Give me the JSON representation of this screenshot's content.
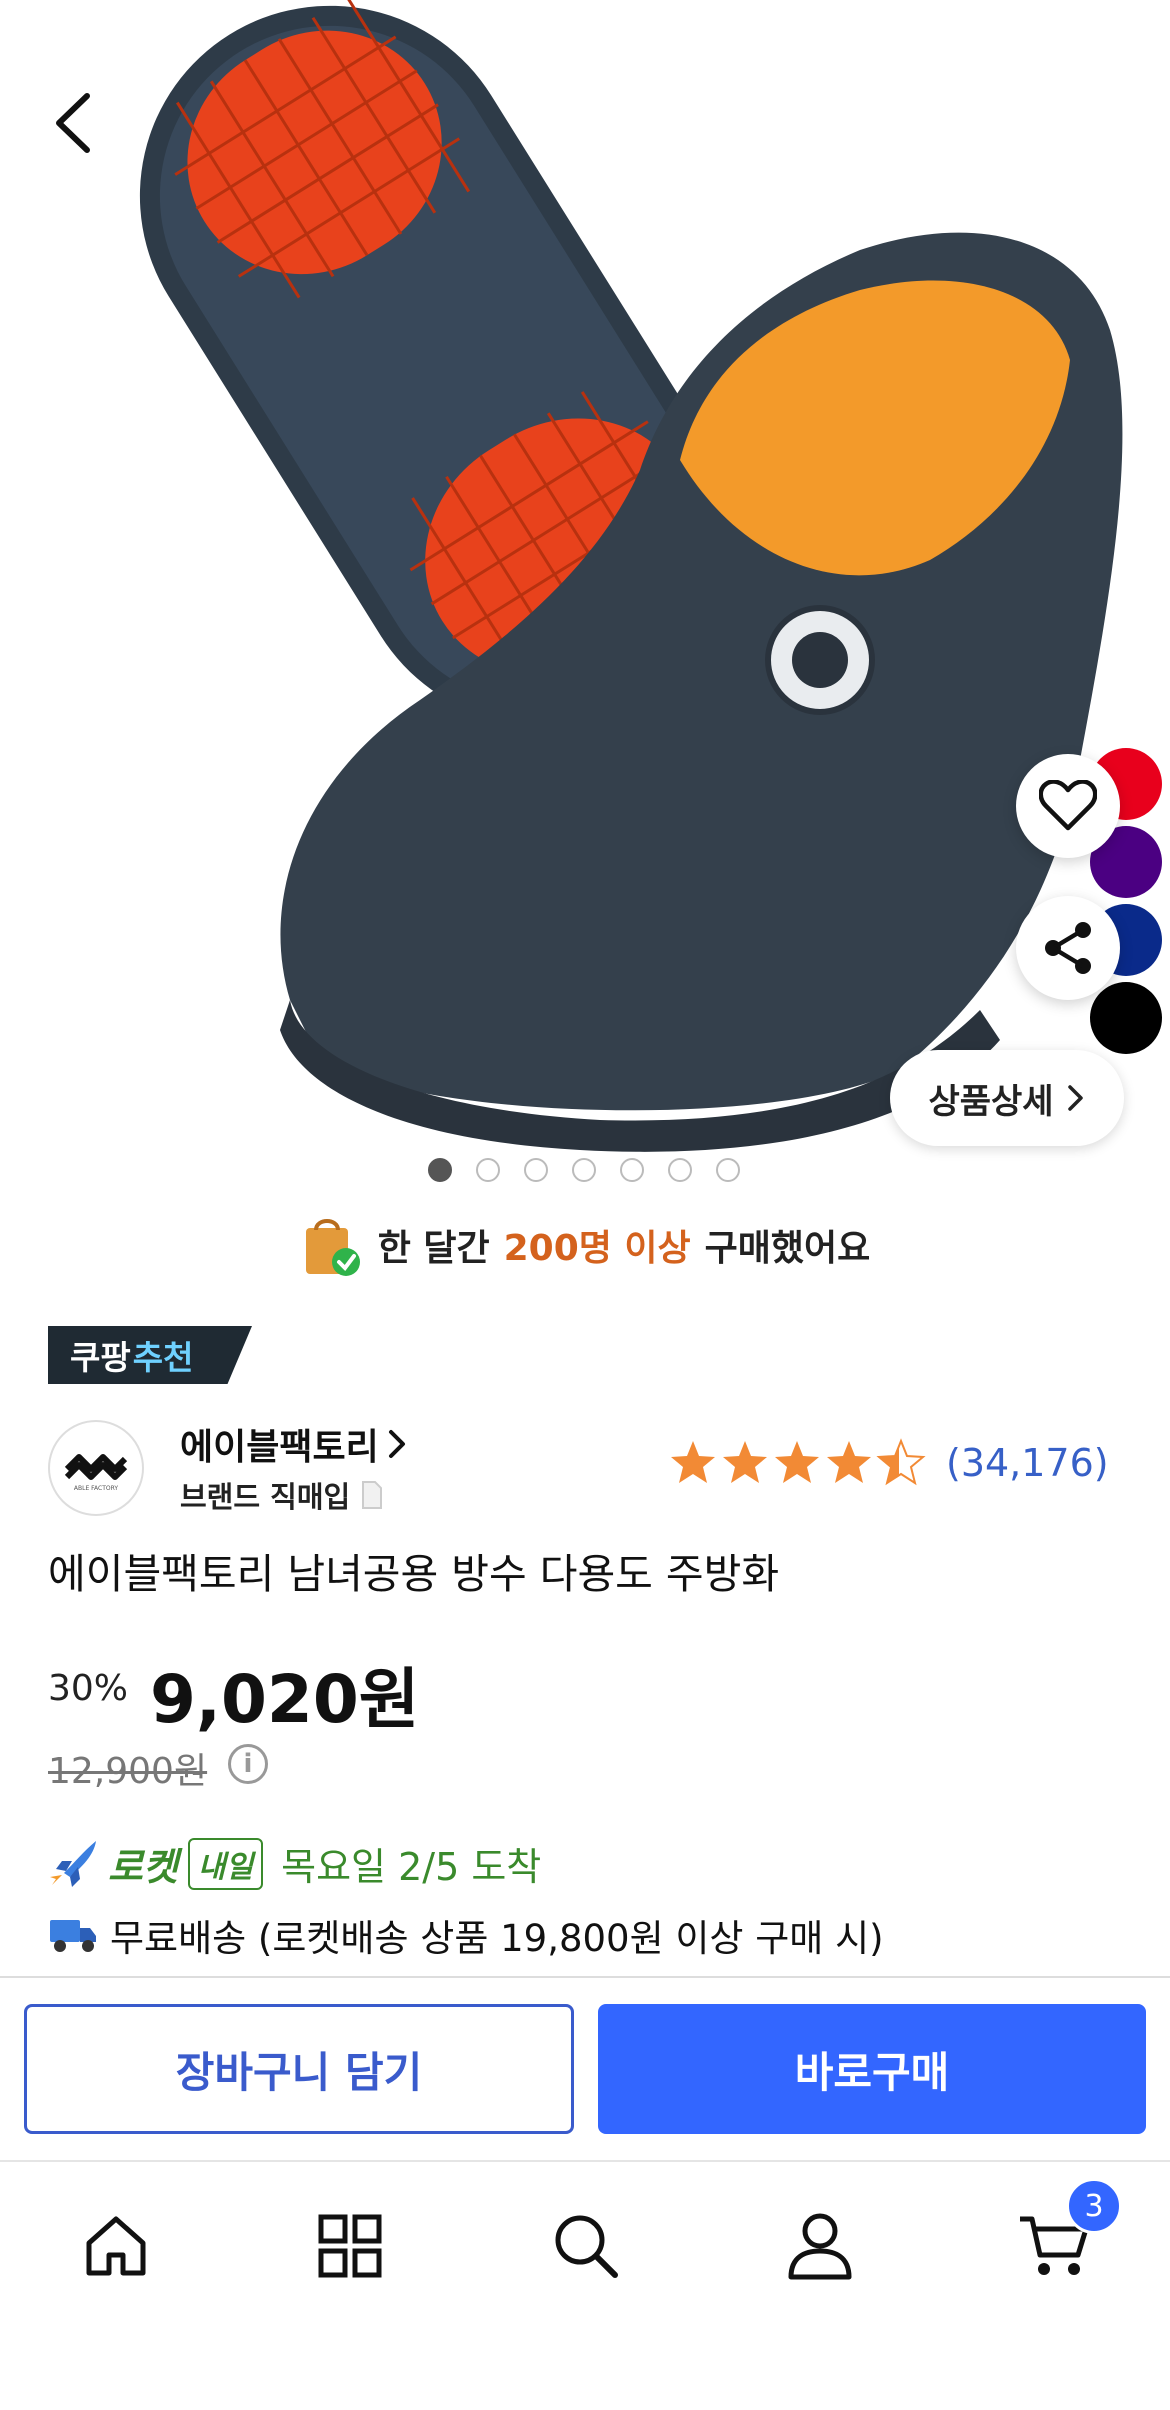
{
  "product_gallery": {
    "active_index": 0,
    "dot_count": 7,
    "color_swatches": [
      "#e8001c",
      "#4b0082",
      "#0a2a8a",
      "#000000"
    ],
    "detail_button_label": "상품상세"
  },
  "social_proof": {
    "prefix": "한 달간",
    "highlight": "200명 이상",
    "suffix": "구매했어요"
  },
  "badge": {
    "part1": "쿠팡",
    "part2": "추천"
  },
  "brand": {
    "name": "에이블팩토리",
    "sub": "브랜드 직매입",
    "logo_caption": "ABLE FACTORY"
  },
  "rating": {
    "stars": 4.5,
    "count": "(34,176)"
  },
  "product_title": "에이블팩토리 남녀공용 방수 다용도 주방화",
  "price": {
    "discount": "30%",
    "sale": "9,020원",
    "original": "12,900원",
    "info_glyph": "i"
  },
  "delivery": {
    "rocket_label": "로켓",
    "tomorrow_label": "내일",
    "arrival": "목요일 2/5 도착",
    "shipping": "무료배송 (로켓배송 상품 19,800원 이상 구매 시)"
  },
  "actions": {
    "cart": "장바구니 담기",
    "buy": "바로구매"
  },
  "bottom_nav": {
    "items": [
      "home-icon",
      "category-icon",
      "search-icon",
      "account-icon",
      "cart-icon"
    ],
    "cart_count": "3"
  },
  "colors": {
    "accent": "#3366ff",
    "rocket_green": "#3a8a2c",
    "social_orange": "#d4621d"
  }
}
